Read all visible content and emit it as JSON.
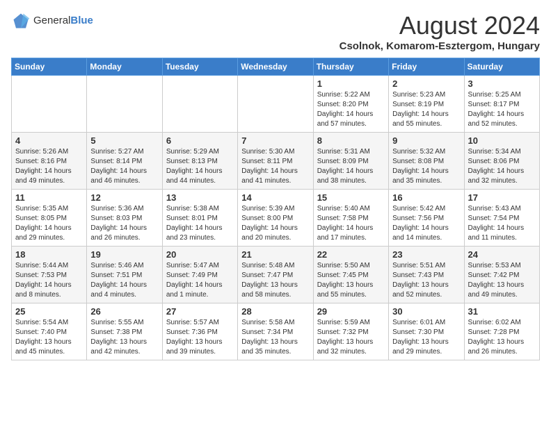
{
  "logo": {
    "text_general": "General",
    "text_blue": "Blue"
  },
  "header": {
    "title": "August 2024",
    "subtitle": "Csolnok, Komarom-Esztergom, Hungary"
  },
  "days_of_week": [
    "Sunday",
    "Monday",
    "Tuesday",
    "Wednesday",
    "Thursday",
    "Friday",
    "Saturday"
  ],
  "weeks": [
    [
      {
        "day": "",
        "info": ""
      },
      {
        "day": "",
        "info": ""
      },
      {
        "day": "",
        "info": ""
      },
      {
        "day": "",
        "info": ""
      },
      {
        "day": "1",
        "info": "Sunrise: 5:22 AM\nSunset: 8:20 PM\nDaylight: 14 hours\nand 57 minutes."
      },
      {
        "day": "2",
        "info": "Sunrise: 5:23 AM\nSunset: 8:19 PM\nDaylight: 14 hours\nand 55 minutes."
      },
      {
        "day": "3",
        "info": "Sunrise: 5:25 AM\nSunset: 8:17 PM\nDaylight: 14 hours\nand 52 minutes."
      }
    ],
    [
      {
        "day": "4",
        "info": "Sunrise: 5:26 AM\nSunset: 8:16 PM\nDaylight: 14 hours\nand 49 minutes."
      },
      {
        "day": "5",
        "info": "Sunrise: 5:27 AM\nSunset: 8:14 PM\nDaylight: 14 hours\nand 46 minutes."
      },
      {
        "day": "6",
        "info": "Sunrise: 5:29 AM\nSunset: 8:13 PM\nDaylight: 14 hours\nand 44 minutes."
      },
      {
        "day": "7",
        "info": "Sunrise: 5:30 AM\nSunset: 8:11 PM\nDaylight: 14 hours\nand 41 minutes."
      },
      {
        "day": "8",
        "info": "Sunrise: 5:31 AM\nSunset: 8:09 PM\nDaylight: 14 hours\nand 38 minutes."
      },
      {
        "day": "9",
        "info": "Sunrise: 5:32 AM\nSunset: 8:08 PM\nDaylight: 14 hours\nand 35 minutes."
      },
      {
        "day": "10",
        "info": "Sunrise: 5:34 AM\nSunset: 8:06 PM\nDaylight: 14 hours\nand 32 minutes."
      }
    ],
    [
      {
        "day": "11",
        "info": "Sunrise: 5:35 AM\nSunset: 8:05 PM\nDaylight: 14 hours\nand 29 minutes."
      },
      {
        "day": "12",
        "info": "Sunrise: 5:36 AM\nSunset: 8:03 PM\nDaylight: 14 hours\nand 26 minutes."
      },
      {
        "day": "13",
        "info": "Sunrise: 5:38 AM\nSunset: 8:01 PM\nDaylight: 14 hours\nand 23 minutes."
      },
      {
        "day": "14",
        "info": "Sunrise: 5:39 AM\nSunset: 8:00 PM\nDaylight: 14 hours\nand 20 minutes."
      },
      {
        "day": "15",
        "info": "Sunrise: 5:40 AM\nSunset: 7:58 PM\nDaylight: 14 hours\nand 17 minutes."
      },
      {
        "day": "16",
        "info": "Sunrise: 5:42 AM\nSunset: 7:56 PM\nDaylight: 14 hours\nand 14 minutes."
      },
      {
        "day": "17",
        "info": "Sunrise: 5:43 AM\nSunset: 7:54 PM\nDaylight: 14 hours\nand 11 minutes."
      }
    ],
    [
      {
        "day": "18",
        "info": "Sunrise: 5:44 AM\nSunset: 7:53 PM\nDaylight: 14 hours\nand 8 minutes."
      },
      {
        "day": "19",
        "info": "Sunrise: 5:46 AM\nSunset: 7:51 PM\nDaylight: 14 hours\nand 4 minutes."
      },
      {
        "day": "20",
        "info": "Sunrise: 5:47 AM\nSunset: 7:49 PM\nDaylight: 14 hours\nand 1 minute."
      },
      {
        "day": "21",
        "info": "Sunrise: 5:48 AM\nSunset: 7:47 PM\nDaylight: 13 hours\nand 58 minutes."
      },
      {
        "day": "22",
        "info": "Sunrise: 5:50 AM\nSunset: 7:45 PM\nDaylight: 13 hours\nand 55 minutes."
      },
      {
        "day": "23",
        "info": "Sunrise: 5:51 AM\nSunset: 7:43 PM\nDaylight: 13 hours\nand 52 minutes."
      },
      {
        "day": "24",
        "info": "Sunrise: 5:53 AM\nSunset: 7:42 PM\nDaylight: 13 hours\nand 49 minutes."
      }
    ],
    [
      {
        "day": "25",
        "info": "Sunrise: 5:54 AM\nSunset: 7:40 PM\nDaylight: 13 hours\nand 45 minutes."
      },
      {
        "day": "26",
        "info": "Sunrise: 5:55 AM\nSunset: 7:38 PM\nDaylight: 13 hours\nand 42 minutes."
      },
      {
        "day": "27",
        "info": "Sunrise: 5:57 AM\nSunset: 7:36 PM\nDaylight: 13 hours\nand 39 minutes."
      },
      {
        "day": "28",
        "info": "Sunrise: 5:58 AM\nSunset: 7:34 PM\nDaylight: 13 hours\nand 35 minutes."
      },
      {
        "day": "29",
        "info": "Sunrise: 5:59 AM\nSunset: 7:32 PM\nDaylight: 13 hours\nand 32 minutes."
      },
      {
        "day": "30",
        "info": "Sunrise: 6:01 AM\nSunset: 7:30 PM\nDaylight: 13 hours\nand 29 minutes."
      },
      {
        "day": "31",
        "info": "Sunrise: 6:02 AM\nSunset: 7:28 PM\nDaylight: 13 hours\nand 26 minutes."
      }
    ]
  ]
}
